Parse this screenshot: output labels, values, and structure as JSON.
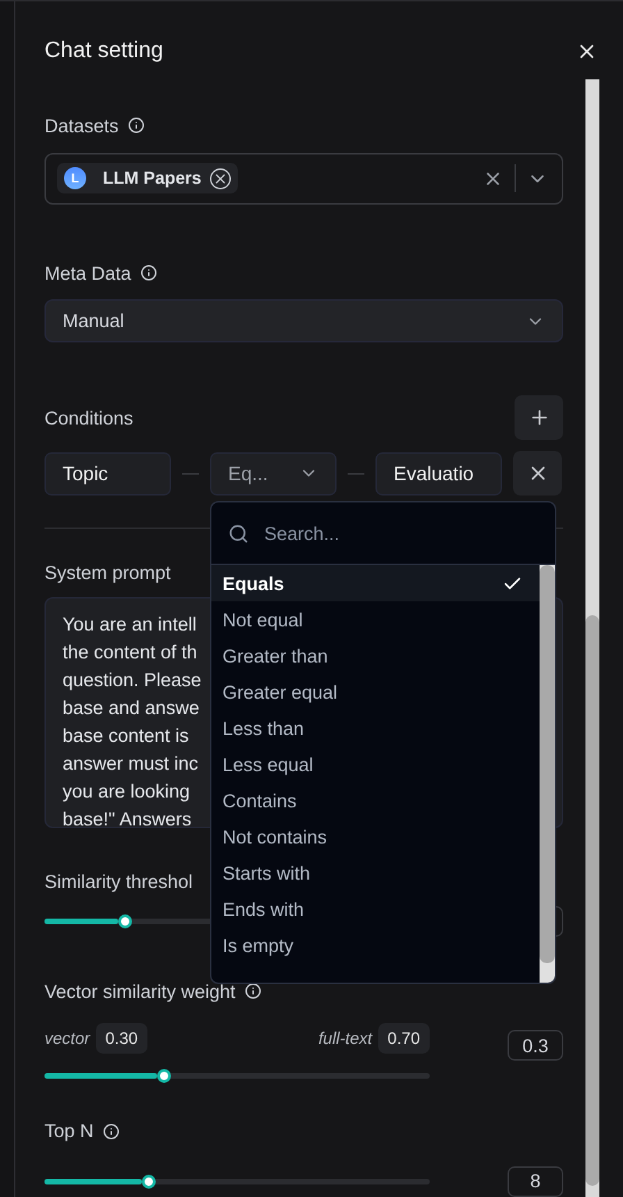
{
  "title": "Chat setting",
  "datasets": {
    "label": "Datasets",
    "tags": [
      {
        "initial": "L",
        "name": "LLM Papers"
      }
    ]
  },
  "meta_data": {
    "label": "Meta Data",
    "value": "Manual"
  },
  "conditions": {
    "label": "Conditions",
    "rows": [
      {
        "field": "Topic",
        "operator": "Eq...",
        "value": "Evaluatio"
      }
    ]
  },
  "operator_menu": {
    "placeholder": "Search...",
    "options": [
      {
        "label": "Equals",
        "selected": true
      },
      {
        "label": "Not equal",
        "selected": false
      },
      {
        "label": "Greater than",
        "selected": false
      },
      {
        "label": "Greater equal",
        "selected": false
      },
      {
        "label": "Less than",
        "selected": false
      },
      {
        "label": "Less equal",
        "selected": false
      },
      {
        "label": "Contains",
        "selected": false
      },
      {
        "label": "Not contains",
        "selected": false
      },
      {
        "label": "Starts with",
        "selected": false
      },
      {
        "label": "Ends with",
        "selected": false
      },
      {
        "label": "Is empty",
        "selected": false
      }
    ]
  },
  "system_prompt": {
    "label": "System prompt",
    "lines": [
      "You are an intell",
      "the content of th",
      "question. Please",
      "base and answe",
      "base content is",
      "answer must inc",
      "you are looking",
      "base!\" Answers"
    ]
  },
  "similarity_threshold": {
    "label": "Similarity threshol",
    "level": 0.21
  },
  "vector_weight": {
    "label": "Vector similarity weight",
    "left_label": "vector",
    "left_value": "0.30",
    "right_label": "full-text",
    "right_value": "0.70",
    "level": 0.31,
    "value": "0.3"
  },
  "top_n": {
    "label": "Top N",
    "level": 0.27,
    "value": "8"
  }
}
